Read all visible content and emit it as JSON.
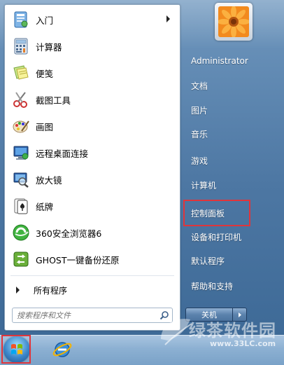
{
  "programs": [
    {
      "label": "入门",
      "icon": "getting-started-icon",
      "submenu": true
    },
    {
      "label": "计算器",
      "icon": "calculator-icon"
    },
    {
      "label": "便笺",
      "icon": "sticky-notes-icon"
    },
    {
      "label": "截图工具",
      "icon": "snipping-tool-icon"
    },
    {
      "label": "画图",
      "icon": "paint-icon"
    },
    {
      "label": "远程桌面连接",
      "icon": "remote-desktop-icon"
    },
    {
      "label": "放大镜",
      "icon": "magnifier-icon"
    },
    {
      "label": "纸牌",
      "icon": "solitaire-icon"
    },
    {
      "label": "360安全浏览器6",
      "icon": "360-browser-icon"
    },
    {
      "label": "GHOST一键备份还原",
      "icon": "ghost-backup-icon"
    }
  ],
  "all_programs": "所有程序",
  "search": {
    "placeholder": "搜索程序和文件"
  },
  "right_menu": [
    {
      "label": "Administrator"
    },
    {
      "label": "文档"
    },
    {
      "label": "图片"
    },
    {
      "label": "音乐"
    },
    {
      "label": "游戏"
    },
    {
      "label": "计算机"
    },
    {
      "label": "控制面板",
      "highlighted": true
    },
    {
      "label": "设备和打印机"
    },
    {
      "label": "默认程序"
    },
    {
      "label": "帮助和支持"
    }
  ],
  "shutdown": {
    "label": "关机"
  },
  "watermark": {
    "text": "绿茶软件园",
    "url": "www.33LC.com"
  },
  "colors": {
    "highlight": "#e0353b",
    "menu_bg": "#4d77a3"
  }
}
